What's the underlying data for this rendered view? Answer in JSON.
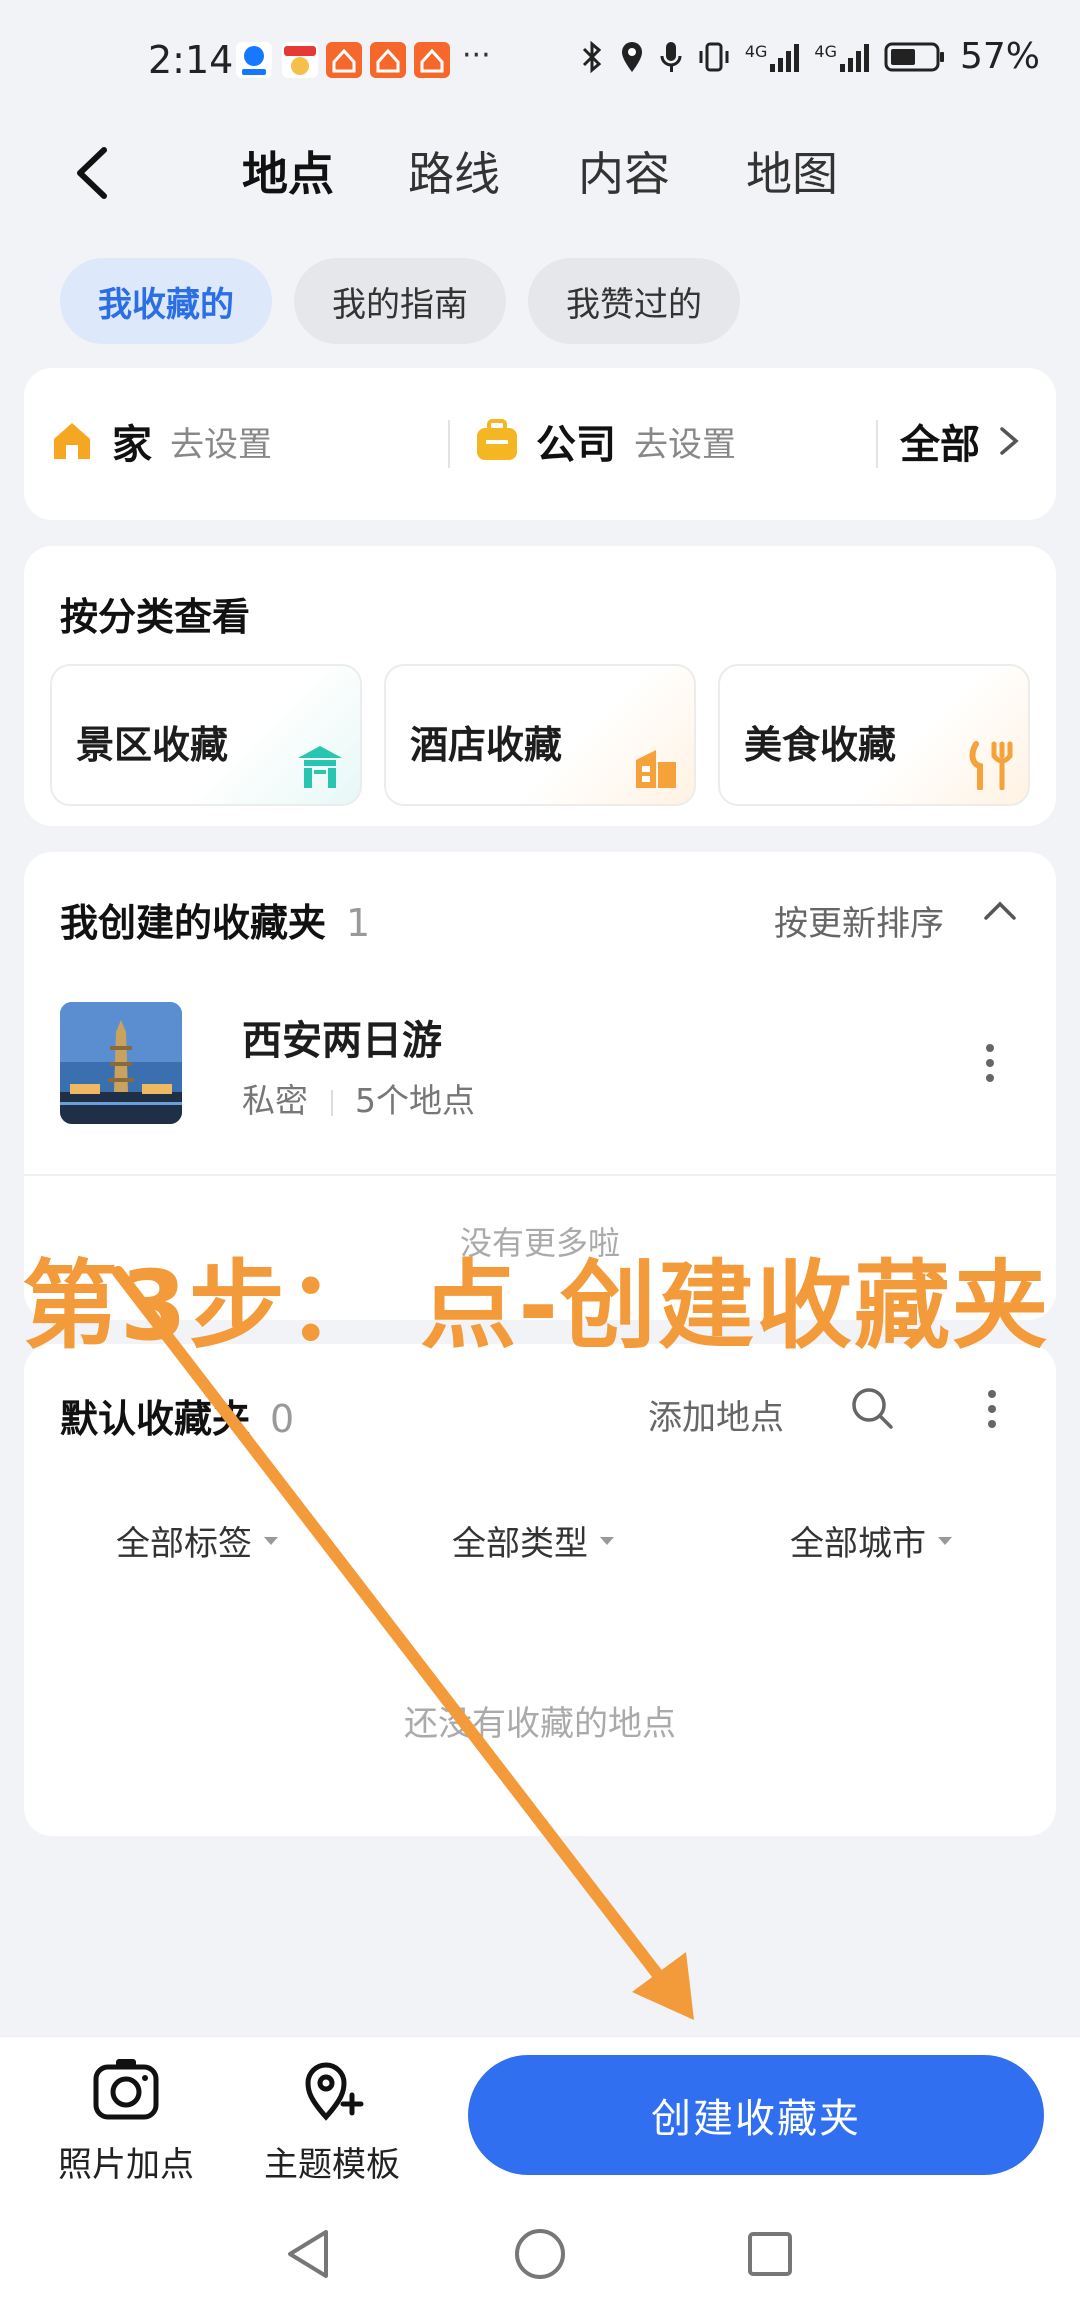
{
  "status_bar": {
    "time": "2:14",
    "app_icons": [
      "alipay-icon",
      "waimai-icon",
      "app-icon-1",
      "app-icon-2",
      "app-icon-3"
    ],
    "more": "···",
    "battery": "57%",
    "network_1": "4G",
    "network_2": "4G"
  },
  "nav": {
    "back_icon": "chevron-left-icon",
    "tabs": [
      "地点",
      "路线",
      "内容",
      "地图"
    ],
    "active_tab": "地点"
  },
  "chips": [
    "我收藏的",
    "我的指南",
    "我赞过的"
  ],
  "home_card": {
    "home": {
      "icon": "home-icon",
      "label": "家",
      "action": "去设置"
    },
    "company": {
      "icon": "briefcase-icon",
      "label": "公司",
      "action": "去设置"
    },
    "all": "全部"
  },
  "category_card": {
    "title": "按分类查看",
    "tiles": [
      {
        "label": "景区收藏",
        "icon": "pavilion-icon"
      },
      {
        "label": "酒店收藏",
        "icon": "hotel-icon"
      },
      {
        "label": "美食收藏",
        "icon": "food-icon"
      }
    ]
  },
  "created_folders": {
    "title": "我创建的收藏夹",
    "count": "1",
    "sort_label": "按更新排序",
    "sort_icon": "chevron-up-icon",
    "items": [
      {
        "name": "西安两日游",
        "privacy": "私密",
        "places": "5个地点",
        "more_icon": "more-vertical-icon"
      }
    ],
    "no_more": "没有更多啦"
  },
  "default_folder": {
    "title": "默认收藏夹",
    "count": "0",
    "add_place": "添加地点",
    "search_icon": "search-icon",
    "more_icon": "more-vertical-icon",
    "filters": [
      "全部标签",
      "全部类型",
      "全部城市"
    ],
    "empty": "还没有收藏的地点"
  },
  "bottom_bar": {
    "photo": {
      "icon": "camera-icon",
      "label": "照片加点"
    },
    "theme": {
      "icon": "location-plus-icon",
      "label": "主题模板"
    },
    "create": "创建收藏夹"
  },
  "system_nav": {
    "icons": [
      "back-triangle-icon",
      "home-circle-icon",
      "recents-square-icon"
    ]
  },
  "annotation": {
    "text": "第3步： 点-创建收藏夹",
    "color": "#f39a3a"
  },
  "colors": {
    "accent": "#2f6ff0",
    "chip_active_bg": "#dde8fb",
    "orange": "#f39a3a",
    "home_icon": "#f5a623"
  }
}
